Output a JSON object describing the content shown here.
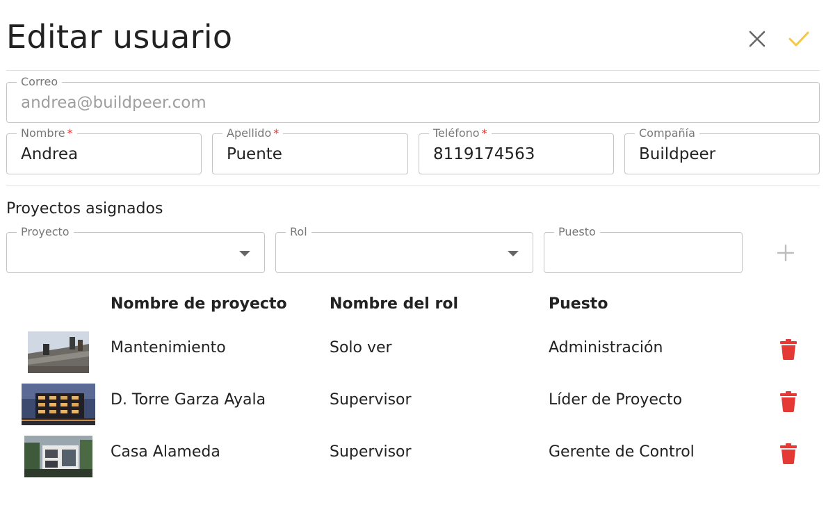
{
  "header": {
    "title": "Editar usuario",
    "close_icon": "close-icon",
    "save_icon": "check-icon",
    "accent_color": "#F6C744"
  },
  "form": {
    "email": {
      "label": "Correo",
      "value": "andrea@buildpeer.com",
      "disabled": true
    },
    "first_name": {
      "label": "Nombre",
      "required_mark": "*",
      "value": "Andrea"
    },
    "last_name": {
      "label": "Apellido",
      "required_mark": "*",
      "value": "Puente"
    },
    "phone": {
      "label": "Teléfono",
      "required_mark": "*",
      "value": "8119174563"
    },
    "company": {
      "label": "Compañía",
      "value": "Buildpeer"
    }
  },
  "projects": {
    "section_title": "Proyectos asignados",
    "project_select": {
      "label": "Proyecto",
      "value": ""
    },
    "role_select": {
      "label": "Rol",
      "value": ""
    },
    "position_input": {
      "label": "Puesto",
      "value": ""
    },
    "add_icon": "plus-icon",
    "table": {
      "headers": [
        "Nombre de proyecto",
        "Nombre del rol",
        "Puesto"
      ],
      "rows": [
        {
          "project": "Mantenimiento",
          "role": "Solo ver",
          "position": "Administración",
          "delete_icon": "trash-icon"
        },
        {
          "project": "D. Torre Garza Ayala",
          "role": "Supervisor",
          "position": "Líder de Proyecto",
          "delete_icon": "trash-icon"
        },
        {
          "project": "Casa Alameda",
          "role": "Supervisor",
          "position": "Gerente de Control",
          "delete_icon": "trash-icon"
        }
      ]
    },
    "delete_color": "#E53935"
  }
}
